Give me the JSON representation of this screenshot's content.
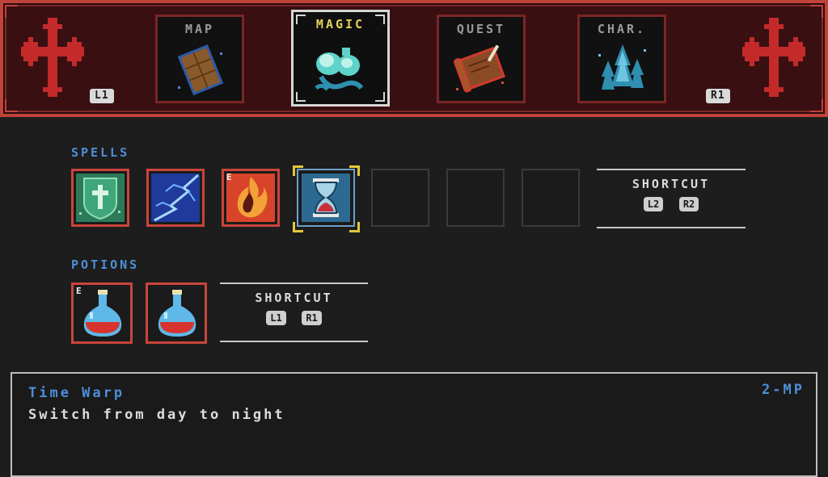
{
  "tabs": [
    {
      "label": "MAP",
      "icon": "map-icon",
      "active": false
    },
    {
      "label": "MAGIC",
      "icon": "magic-potions-icon",
      "active": true
    },
    {
      "label": "QUEST",
      "icon": "scroll-icon",
      "active": false
    },
    {
      "label": "CHAR.",
      "icon": "character-icon",
      "active": false
    }
  ],
  "nav_hints": {
    "left": "L1",
    "right": "R1"
  },
  "spells": {
    "title": "SPELLS",
    "slots": [
      {
        "icon": "holy-shield-icon",
        "equipped": false
      },
      {
        "icon": "lightning-icon",
        "equipped": false
      },
      {
        "icon": "fire-icon",
        "equipped": true,
        "equipped_mark": "E"
      },
      {
        "icon": "hourglass-icon",
        "selected": true
      },
      {
        "icon": null
      },
      {
        "icon": null
      },
      {
        "icon": null
      }
    ],
    "shortcut": {
      "label": "SHORTCUT",
      "keys": [
        "L2",
        "R2"
      ]
    }
  },
  "potions": {
    "title": "POTIONS",
    "slots": [
      {
        "icon": "red-potion-icon",
        "equipped": true,
        "equipped_mark": "E"
      },
      {
        "icon": "red-potion-icon",
        "equipped": false
      }
    ],
    "shortcut": {
      "label": "SHORTCUT",
      "keys": [
        "L1",
        "R1"
      ]
    }
  },
  "description": {
    "title": "Time Warp",
    "cost": "2-MP",
    "text": "Switch from day to night"
  },
  "colors": {
    "accent_blue": "#4d8fd8",
    "accent_red": "#c0433a",
    "active_tab_label": "#e2d35a",
    "selection": "#e2c83a"
  }
}
